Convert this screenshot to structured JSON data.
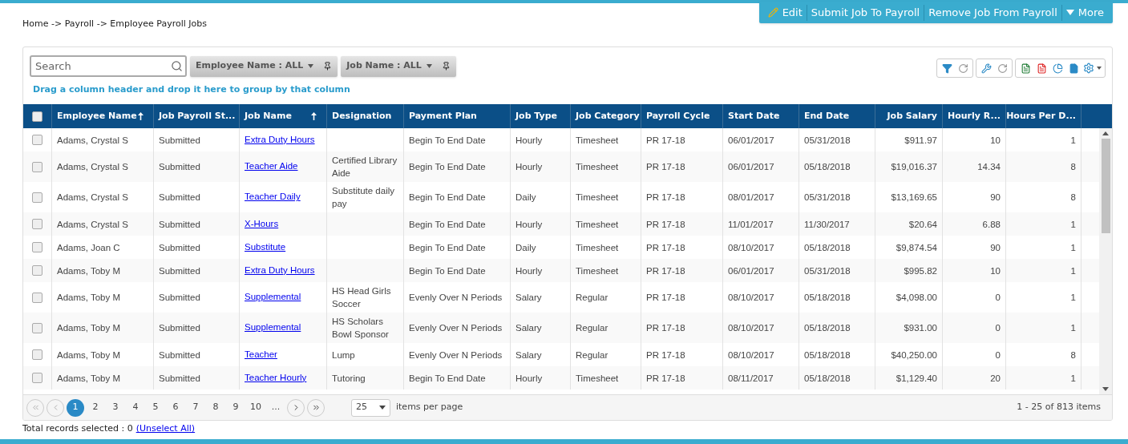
{
  "breadcrumb": "Home -> Payroll -> Employee Payroll Jobs",
  "actions": [
    {
      "kind": "edit",
      "label": "Edit"
    },
    {
      "kind": "plain",
      "label": "Submit Job To Payroll"
    },
    {
      "kind": "plain",
      "label": "Remove Job From Payroll"
    },
    {
      "kind": "menu",
      "label": "More"
    }
  ],
  "search": {
    "placeholder": "Search"
  },
  "filters": [
    "Employee Name : ALL",
    "Job Name : ALL"
  ],
  "group_hint": "Drag a column header and drop it here to group by that column",
  "columns": [
    {
      "label": "Employee Name",
      "sorted": true,
      "kind": "text"
    },
    {
      "label": "Job Payroll St...",
      "sorted": false,
      "kind": "text"
    },
    {
      "label": "Job Name",
      "sorted": true,
      "kind": "link"
    },
    {
      "label": "Designation",
      "sorted": false,
      "kind": "text"
    },
    {
      "label": "Payment Plan",
      "sorted": false,
      "kind": "text"
    },
    {
      "label": "Job Type",
      "sorted": false,
      "kind": "text"
    },
    {
      "label": "Job Category",
      "sorted": false,
      "kind": "text"
    },
    {
      "label": "Payroll Cycle",
      "sorted": false,
      "kind": "text"
    },
    {
      "label": "Start Date",
      "sorted": false,
      "kind": "text"
    },
    {
      "label": "End Date",
      "sorted": false,
      "kind": "text"
    },
    {
      "label": "Job Salary",
      "sorted": false,
      "kind": "number"
    },
    {
      "label": "Hourly R...",
      "sorted": false,
      "kind": "number"
    },
    {
      "label": "Hours Per D...",
      "sorted": false,
      "kind": "number"
    }
  ],
  "select_all": {
    "checked": false
  },
  "rows": [
    {
      "checked": false,
      "cells": [
        "Adams, Crystal S",
        "Submitted",
        "Extra Duty Hours",
        "",
        "Begin To End Date",
        "Hourly",
        "Timesheet",
        "PR 17-18",
        "06/01/2017",
        "05/31/2018",
        "$911.97",
        "10",
        "1"
      ]
    },
    {
      "checked": false,
      "cells": [
        "Adams, Crystal S",
        "Submitted",
        "Teacher Aide",
        "Certified Library Aide",
        "Begin To End Date",
        "Hourly",
        "Timesheet",
        "PR 17-18",
        "06/01/2017",
        "05/18/2018",
        "$19,016.37",
        "14.34",
        "8"
      ]
    },
    {
      "checked": false,
      "cells": [
        "Adams, Crystal S",
        "Submitted",
        "Teacher Daily",
        "Substitute daily pay",
        "Begin To End Date",
        "Daily",
        "Timesheet",
        "PR 17-18",
        "08/01/2017",
        "05/31/2018",
        "$13,169.65",
        "90",
        "8"
      ]
    },
    {
      "checked": false,
      "cells": [
        "Adams, Crystal S",
        "Submitted",
        "X-Hours",
        "",
        "Begin To End Date",
        "Hourly",
        "Timesheet",
        "PR 17-18",
        "11/01/2017",
        "11/30/2017",
        "$20.64",
        "6.88",
        "1"
      ]
    },
    {
      "checked": false,
      "cells": [
        "Adams, Joan C",
        "Submitted",
        "Substitute",
        "",
        "Begin To End Date",
        "Daily",
        "Timesheet",
        "PR 17-18",
        "08/10/2017",
        "05/18/2018",
        "$9,874.54",
        "90",
        "1"
      ]
    },
    {
      "checked": false,
      "cells": [
        "Adams, Toby M",
        "Submitted",
        "Extra Duty Hours",
        "",
        "Begin To End Date",
        "Hourly",
        "Timesheet",
        "PR 17-18",
        "06/01/2017",
        "05/31/2018",
        "$995.82",
        "10",
        "1"
      ]
    },
    {
      "checked": false,
      "cells": [
        "Adams, Toby M",
        "Submitted",
        "Supplemental",
        "HS Head Girls Soccer",
        "Evenly Over N Periods",
        "Salary",
        "Regular",
        "PR 17-18",
        "08/10/2017",
        "05/18/2018",
        "$4,098.00",
        "0",
        "1"
      ]
    },
    {
      "checked": false,
      "cells": [
        "Adams, Toby M",
        "Submitted",
        "Supplemental",
        "HS Scholars Bowl Sponsor",
        "Evenly Over N Periods",
        "Salary",
        "Regular",
        "PR 17-18",
        "08/10/2017",
        "05/18/2018",
        "$931.00",
        "0",
        "1"
      ]
    },
    {
      "checked": false,
      "cells": [
        "Adams, Toby M",
        "Submitted",
        "Teacher",
        "Lump",
        "Evenly Over N Periods",
        "Salary",
        "Regular",
        "PR 17-18",
        "08/10/2017",
        "05/18/2018",
        "$40,250.00",
        "0",
        "8"
      ]
    },
    {
      "checked": false,
      "cells": [
        "Adams, Toby M",
        "Submitted",
        "Teacher Hourly",
        "Tutoring",
        "Begin To End Date",
        "Hourly",
        "Timesheet",
        "PR 17-18",
        "08/11/2017",
        "05/18/2018",
        "$1,129.40",
        "20",
        "1"
      ]
    }
  ],
  "pages": [
    {
      "label": "1",
      "selected": true
    },
    {
      "label": "2",
      "selected": false
    },
    {
      "label": "3",
      "selected": false
    },
    {
      "label": "4",
      "selected": false
    },
    {
      "label": "5",
      "selected": false
    },
    {
      "label": "6",
      "selected": false
    },
    {
      "label": "7",
      "selected": false
    },
    {
      "label": "8",
      "selected": false
    },
    {
      "label": "9",
      "selected": false
    },
    {
      "label": "10",
      "selected": false
    },
    {
      "label": "...",
      "selected": false
    }
  ],
  "page_size": "25",
  "page_size_label": "items per page",
  "range": "1 - 25 of 813 items",
  "footer": {
    "text": "Total records selected : 0",
    "link": "(Unselect All)"
  }
}
